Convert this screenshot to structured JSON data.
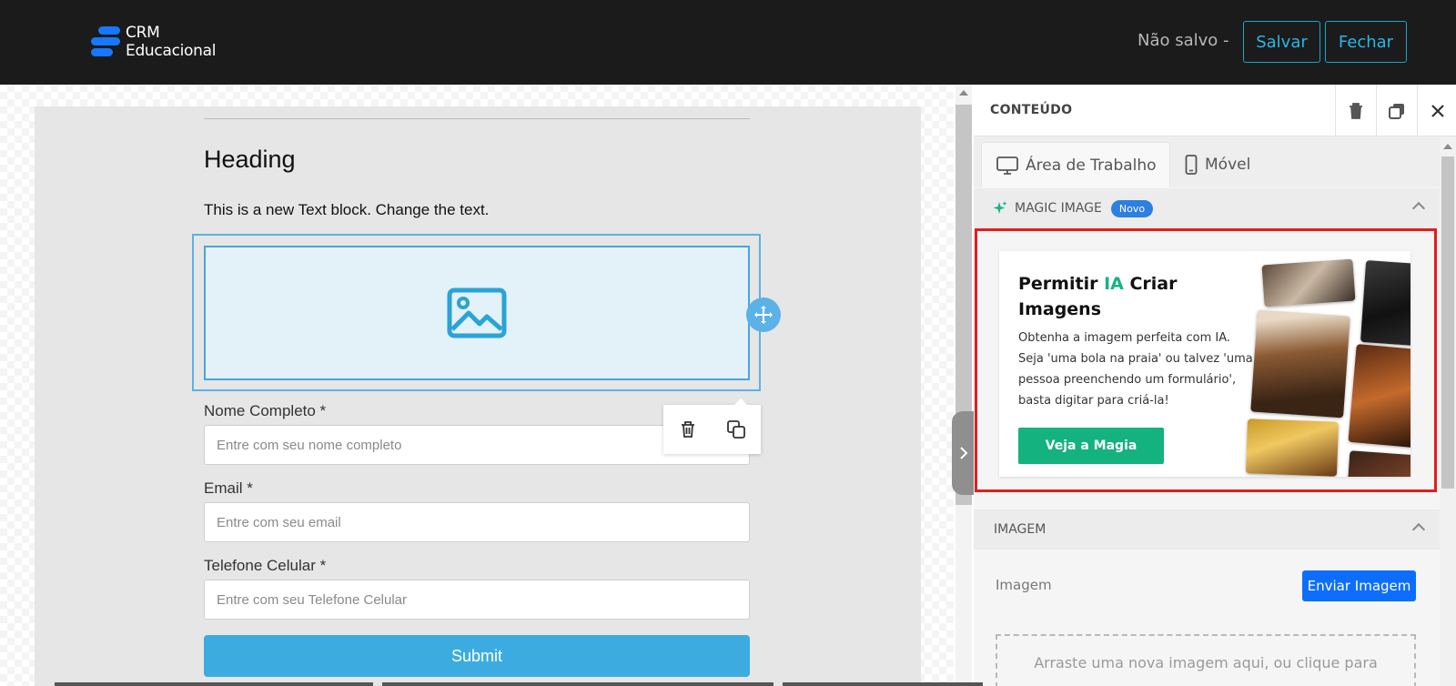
{
  "topbar": {
    "logo_line1": "CRM",
    "logo_line2": "Educacional",
    "save_status": "Não salvo -",
    "save_label": "Salvar",
    "close_label": "Fechar",
    "accent": "#29b6e8"
  },
  "canvas": {
    "heading": "Heading",
    "text_block": "This is a new Text block. Change the text.",
    "fields": [
      {
        "label": "Nome Completo *",
        "placeholder": "Entre com seu nome completo"
      },
      {
        "label": "Email *",
        "placeholder": "Entre com seu email"
      },
      {
        "label": "Telefone Celular *",
        "placeholder": "Entre com seu Telefone Celular"
      }
    ],
    "submit_label": "Submit",
    "image_placeholder_icon": "image-icon",
    "toolbar_icons": [
      "trash-icon",
      "duplicate-icon"
    ]
  },
  "panel": {
    "title": "CONTEÚDO",
    "header_icons": [
      "trash-icon",
      "duplicate-icon",
      "close-icon"
    ],
    "tabs": [
      {
        "label": "Área de Trabalho",
        "icon": "desktop-icon",
        "active": true
      },
      {
        "label": "Móvel",
        "icon": "mobile-icon",
        "active": false
      }
    ],
    "magic_image": {
      "section_title": "MAGIC IMAGE",
      "badge": "Novo",
      "card_title_before": "Permitir ",
      "card_title_highlight": "IA",
      "card_title_after": " Criar Imagens",
      "description": "Obtenha a imagem perfeita com IA. Seja 'uma bola na praia' ou talvez 'uma pessoa preenchendo um formulário', basta digitar para criá-la!",
      "button_label": "Veja a Magia",
      "highlight_color": "#17b28a",
      "button_color": "#14b27e"
    },
    "image_section": {
      "title": "IMAGEM",
      "label": "Imagem",
      "upload_label": "Enviar Imagem",
      "dropzone_text": "Arraste uma nova imagem aqui, ou clique para"
    }
  }
}
